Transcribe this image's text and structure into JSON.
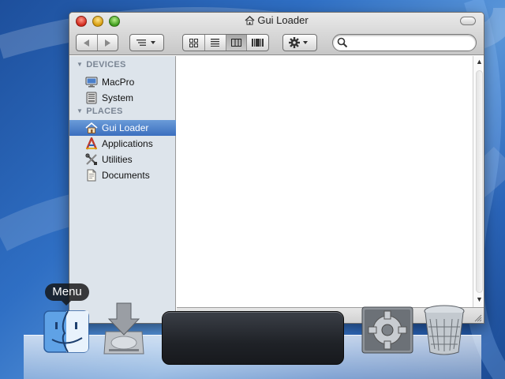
{
  "window": {
    "title": "Gui Loader"
  },
  "toolbar": {
    "back_icon": "back-arrow-icon",
    "forward_icon": "forward-arrow-icon",
    "path_icon": "path-menu-icon",
    "view_modes": [
      "icon-view-icon",
      "list-view-icon",
      "column-view-icon",
      "coverflow-view-icon"
    ],
    "active_view": "column-view-icon",
    "action_icon": "gear-icon",
    "search_placeholder": ""
  },
  "sidebar": {
    "devices_header": "DEVICES",
    "places_header": "PLACES",
    "devices": [
      {
        "label": "MacPro",
        "icon": "computer-icon"
      },
      {
        "label": "System",
        "icon": "hard-drive-icon"
      }
    ],
    "places": [
      {
        "label": "Gui Loader",
        "icon": "house-icon",
        "selected": true
      },
      {
        "label": "Applications",
        "icon": "applications-icon"
      },
      {
        "label": "Utilities",
        "icon": "utilities-icon"
      },
      {
        "label": "Documents",
        "icon": "document-icon"
      }
    ]
  },
  "dock": {
    "tooltip": "Menu",
    "items": [
      "finder-icon",
      "installer-icon",
      "system-preferences-icon",
      "trash-icon"
    ]
  },
  "colors": {
    "selection": "#3b6fbf",
    "sidebar_bg": "#dde4eb",
    "desktop": "#2f6fc4"
  }
}
